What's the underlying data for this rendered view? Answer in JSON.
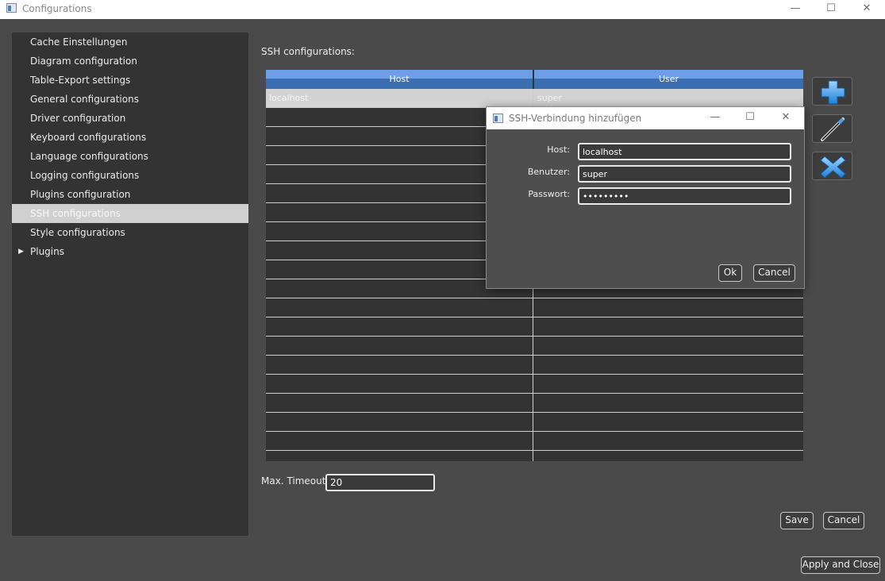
{
  "window": {
    "title": "Configurations",
    "minimize": "—",
    "maximize": "☐",
    "close": "✕"
  },
  "sidebar": {
    "items": [
      {
        "label": "Cache Einstellungen"
      },
      {
        "label": "Diagram configuration"
      },
      {
        "label": "Table-Export settings"
      },
      {
        "label": "General configurations"
      },
      {
        "label": "Driver configuration"
      },
      {
        "label": "Keyboard configurations"
      },
      {
        "label": "Language configurations"
      },
      {
        "label": "Logging configurations"
      },
      {
        "label": "Plugins configuration"
      },
      {
        "label": "SSH configurations",
        "selected": true
      },
      {
        "label": "Style configurations"
      },
      {
        "label": "Plugins",
        "expandable": true,
        "arrow": "▶"
      }
    ]
  },
  "main": {
    "section_label": "SSH configurations:",
    "table": {
      "columns": [
        "Host",
        "User"
      ],
      "rows": [
        {
          "host": "localhost",
          "user": "super"
        }
      ]
    },
    "actions": {
      "add_icon": "plus-icon",
      "edit_icon": "pencil-icon",
      "delete_icon": "x-icon"
    },
    "timeout_label": "Max. Timeout:",
    "timeout_value": "20",
    "save_label": "Save",
    "cancel_label": "Cancel",
    "apply_close_label": "Apply and Close"
  },
  "dialog": {
    "title": "SSH-Verbindung hinzufügen",
    "minimize": "—",
    "maximize": "☐",
    "close": "✕",
    "host_label": "Host:",
    "host_value": "localhost",
    "user_label": "Benutzer:",
    "user_value": "super",
    "password_label": "Passwort:",
    "password_value": "superuser",
    "ok_label": "Ok",
    "cancel_label": "Cancel"
  }
}
